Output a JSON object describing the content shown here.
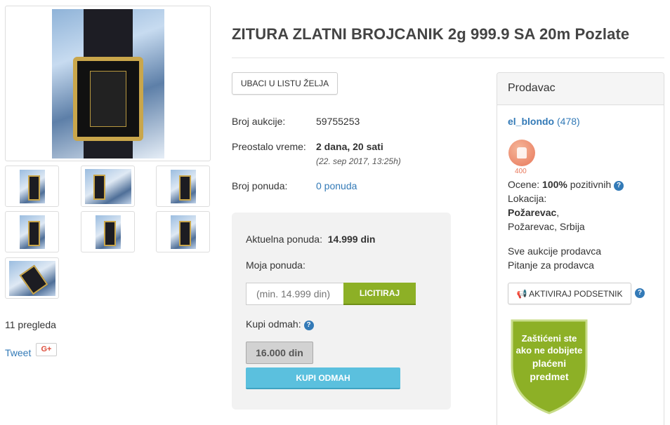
{
  "listing": {
    "title": "ZITURA ZLATNI BROJCANIK 2g 999.9 SA 20m Pozlate",
    "views": "11 pregleda",
    "tweet": "Tweet",
    "gplus": "G+"
  },
  "actions": {
    "wishlist": "UBACI U LISTU ŽELJA"
  },
  "details": {
    "auction_label": "Broj aukcije:",
    "auction_value": "59755253",
    "time_label": "Preostalo vreme:",
    "time_value": "2 dana, 20 sati",
    "time_date": "(22. sep 2017, 13:25h)",
    "bids_label": "Broj ponuda:",
    "bids_value": "0 ponuda"
  },
  "bid": {
    "current_label": "Aktuelna ponuda:",
    "current_value": "14.999 din",
    "my_bid_label": "Moja ponuda:",
    "input_placeholder": "(min. 14.999 din)",
    "bid_button": "LICITIRAJ",
    "buy_now_label": "Kupi odmah:",
    "buy_now_price": "16.000 din",
    "buy_now_button": "KUPI ODMAH",
    "help_icon": "?"
  },
  "seller": {
    "heading": "Prodavac",
    "name": "el_blondo",
    "rating_count": "(478)",
    "badge_value": "400",
    "ratings_prefix": "Ocene:",
    "ratings_percent": "100%",
    "ratings_suffix": "pozitivnih",
    "location_label": "Lokacija:",
    "city": "Požarevac",
    "region": "Požarevac, Srbija",
    "all_auctions": "Sve aukcije prodavca",
    "question": "Pitanje za prodavca",
    "reminder_button": "AKTIVIRAJ PODSETNIK",
    "shield_lines": [
      "Zaštićeni ste",
      "ako ne dobijete",
      "plaćeni",
      "predmet"
    ]
  },
  "colors": {
    "link": "#337ab7",
    "bid_button": "#8db026",
    "buy_button": "#5bc0de",
    "shield": "#8db026"
  }
}
